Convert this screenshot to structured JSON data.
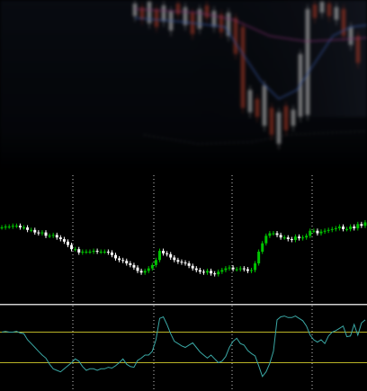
{
  "colors": {
    "background": "#000000",
    "bull_candle": "#00c400",
    "bear_candle": "#ffffff",
    "grid_vline": "#c9c9c9",
    "separator": "#cfcfcf",
    "osc_line": "#3aa7a4",
    "osc_level": "#b9b327",
    "hero_bull": "#d8d8d8",
    "hero_bear": "#b8402c",
    "hero_ma_blue": "#3f62b8",
    "hero_ma_magenta": "#a03b8a"
  },
  "icons": {
    "candles": "candlestick-icon",
    "oscillator": "oscillator-line-icon"
  },
  "chart_data": [
    {
      "type": "candlestick",
      "title": "",
      "xlabel": "",
      "ylabel": "",
      "ylim": [
        0,
        100
      ],
      "grid": false,
      "closes": [
        86,
        87,
        87,
        88,
        88,
        86,
        86,
        83,
        83,
        80,
        79,
        80,
        76,
        76,
        77,
        74,
        72,
        69,
        65,
        60,
        60,
        56,
        57,
        57,
        57,
        58,
        57,
        57,
        57,
        56,
        53,
        49,
        47,
        46,
        43,
        41,
        38,
        34,
        32,
        34,
        37,
        41,
        47,
        58,
        55,
        54,
        50,
        47,
        45,
        44,
        43,
        40,
        37,
        35,
        33,
        32,
        34,
        31,
        30,
        33,
        35,
        37,
        38,
        36,
        36,
        37,
        36,
        34,
        35,
        43,
        57,
        67,
        76,
        79,
        79,
        77,
        74,
        74,
        72,
        71,
        75,
        73,
        74,
        76,
        82,
        82,
        79,
        81,
        82,
        83,
        84,
        85,
        87,
        84,
        84,
        87,
        85,
        90,
        88,
        92
      ]
    },
    {
      "type": "line",
      "title": "",
      "xlabel": "",
      "ylabel": "",
      "ylim": [
        0,
        100
      ],
      "levels": [
        70,
        30
      ],
      "values": [
        70,
        71,
        70,
        70,
        71,
        69,
        68,
        60,
        55,
        50,
        45,
        40,
        36,
        28,
        22,
        20,
        18,
        22,
        26,
        30,
        35,
        32,
        25,
        20,
        22,
        22,
        20,
        22,
        22,
        24,
        23,
        26,
        30,
        35,
        28,
        25,
        24,
        33,
        36,
        40,
        40,
        45,
        60,
        88,
        90,
        80,
        68,
        58,
        55,
        52,
        50,
        53,
        56,
        50,
        44,
        40,
        36,
        40,
        35,
        30,
        32,
        38,
        50,
        58,
        62,
        55,
        53,
        46,
        42,
        39,
        26,
        12,
        18,
        29,
        45,
        86,
        90,
        91,
        89,
        89,
        91,
        88,
        85,
        78,
        66,
        60,
        57,
        60,
        55,
        65,
        70,
        72,
        75,
        78,
        64,
        65,
        80,
        66,
        82,
        86
      ]
    }
  ]
}
